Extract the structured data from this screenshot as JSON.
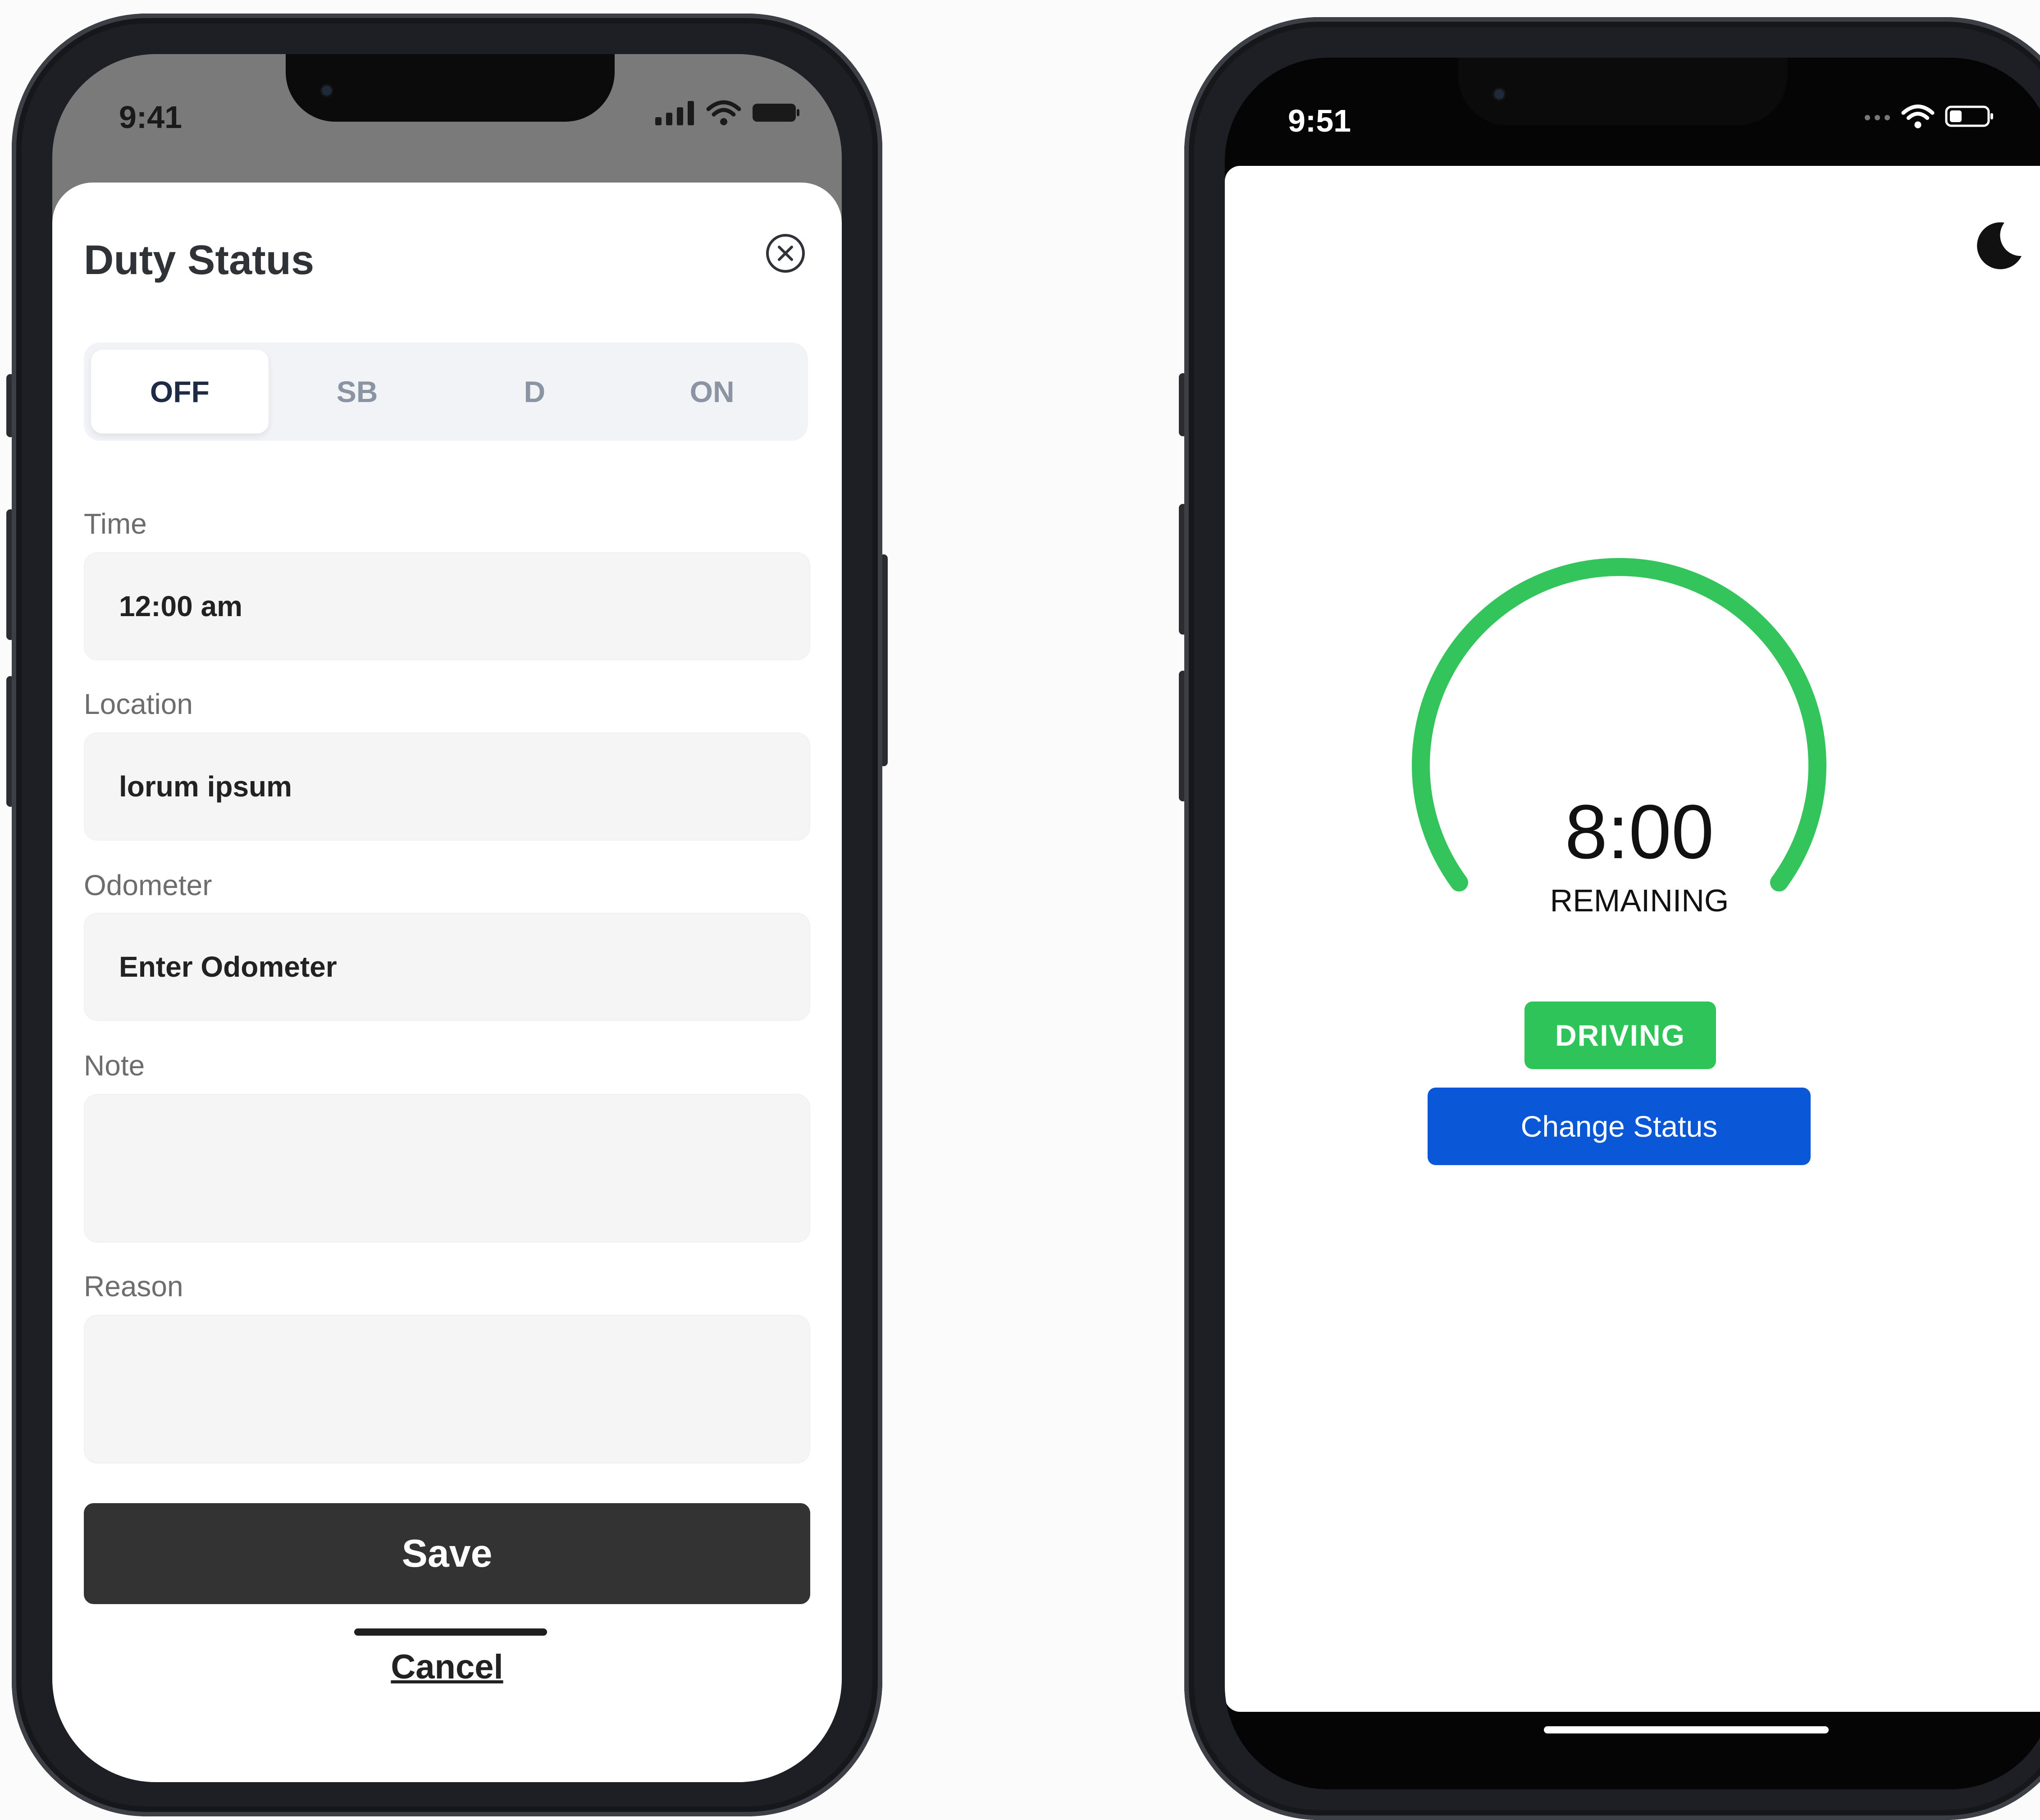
{
  "colors": {
    "accent_green": "#2ec459",
    "accent_blue": "#0a57d8",
    "dark_button": "#333333",
    "device_frame": "#1d1f24"
  },
  "left_phone": {
    "status_bar": {
      "time": "9:41",
      "icons": [
        "signal-bars-icon",
        "wifi-icon",
        "battery-full-icon"
      ]
    },
    "sheet": {
      "title": "Duty Status",
      "close_icon": "close-circle-icon",
      "segments": [
        {
          "label": "OFF",
          "selected": true
        },
        {
          "label": "SB",
          "selected": false
        },
        {
          "label": "D",
          "selected": false
        },
        {
          "label": "ON",
          "selected": false
        }
      ],
      "fields": {
        "time": {
          "label": "Time",
          "value": "12:00 am"
        },
        "location": {
          "label": "Location",
          "value": "lorum ipsum"
        },
        "odometer": {
          "label": "Odometer",
          "placeholder": "Enter Odometer"
        },
        "note": {
          "label": "Note",
          "value": ""
        },
        "reason": {
          "label": "Reason",
          "value": ""
        }
      },
      "save_label": "Save",
      "cancel_label": "Cancel"
    }
  },
  "right_phone": {
    "status_bar": {
      "time": "9:51",
      "icons": [
        "signal-dots-icon",
        "wifi-icon",
        "battery-low-icon"
      ]
    },
    "theme_icon": "moon-icon",
    "gauge": {
      "time_remaining": "8:00",
      "caption": "REMAINING",
      "fraction_remaining": 1.0
    },
    "status_badge": "DRIVING",
    "change_status_label": "Change Status"
  }
}
